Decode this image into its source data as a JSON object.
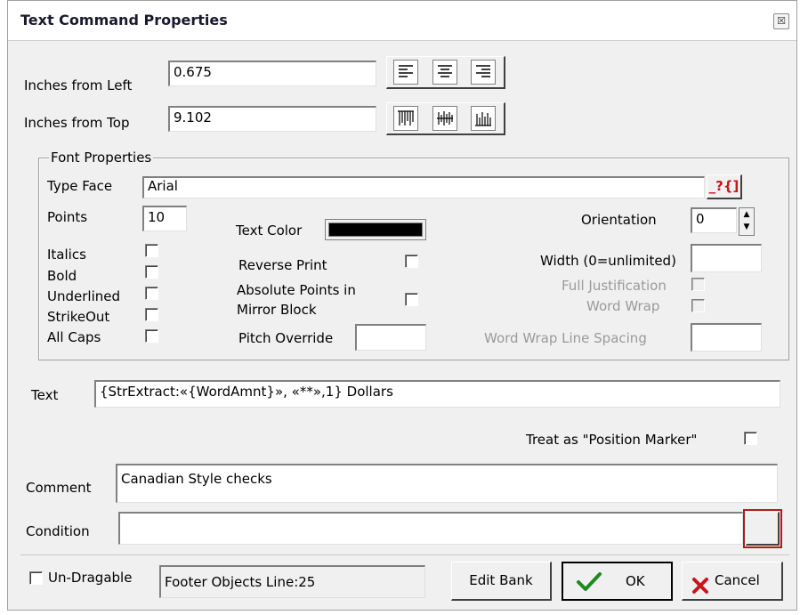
{
  "window": {
    "title": "Text Command Properties",
    "close_glyph": "☒"
  },
  "position": {
    "left_label": "Inches from Left",
    "left_value": "0.675",
    "top_label": "Inches from Top",
    "top_value": "9.102"
  },
  "font": {
    "group_label": "Font Properties",
    "typeface_label": "Type Face",
    "typeface_value": "Arial",
    "typeface_help": "_?{]",
    "points_label": "Points",
    "points_value": "10",
    "text_color_label": "Text Color",
    "text_color": "#000000",
    "italics_label": "Italics",
    "bold_label": "Bold",
    "underlined_label": "Underlined",
    "strikeout_label": "StrikeOut",
    "allcaps_label": "All Caps",
    "reverse_print_label": "Reverse Print",
    "absolute_points_label_1": "Absolute Points in",
    "absolute_points_label_2": "Mirror Block",
    "pitch_override_label": "Pitch Override",
    "pitch_override_value": "",
    "orientation_label": "Orientation",
    "orientation_value": "0",
    "width_label": "Width (0=unlimited)",
    "width_value": "",
    "full_justification_label": "Full Justification",
    "word_wrap_label": "Word Wrap",
    "word_wrap_spacing_label": "Word Wrap Line Spacing",
    "word_wrap_spacing_value": ""
  },
  "text": {
    "label": "Text",
    "value": "{StrExtract:«{WordAmnt}», «**»,1} Dollars"
  },
  "position_marker_label": "Treat as \"Position Marker\"",
  "comment": {
    "label": "Comment",
    "value": "Canadian Style checks"
  },
  "condition": {
    "label": "Condition",
    "value": ""
  },
  "footer": {
    "undragable_label": "Un-Dragable",
    "status_value": "Footer Objects  Line:25",
    "edit_bank_label": "Edit Bank",
    "ok_label": "OK",
    "cancel_label": "Cancel"
  },
  "colors": {
    "accent_red": "#b31b1b",
    "ok_green": "#1e8a1e",
    "cancel_red": "#c8161d"
  }
}
